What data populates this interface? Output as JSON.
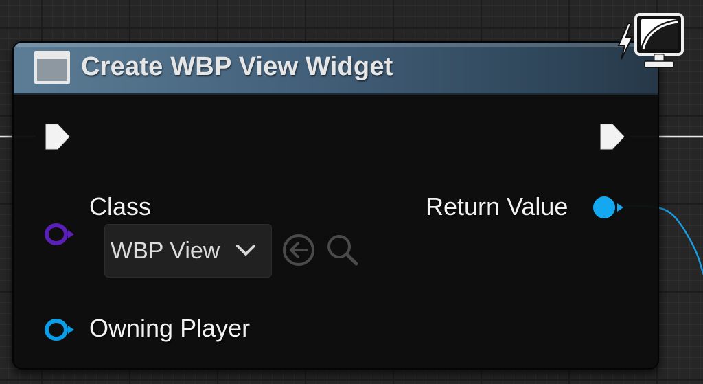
{
  "node": {
    "title": "Create WBP View Widget",
    "header_icon": "widget-icon",
    "badge_icon": "client-only-lightning-monitor-icon"
  },
  "pins": {
    "exec_in": "exec-input-pin",
    "exec_out": "exec-output-pin",
    "class": {
      "label": "Class",
      "selected_value": "WBP View",
      "browse_icon": "use-selected-asset-arrow-icon",
      "search_icon": "search-icon"
    },
    "owning_player": {
      "label": "Owning Player"
    },
    "return_value": {
      "label": "Return Value"
    }
  },
  "colors": {
    "class_pin": "#5a1fb8",
    "object_pin": "#0a9de8",
    "return_pin": "#14a8f0",
    "header": "#4a677f",
    "wire_exec": "#e8e8e8",
    "wire_data": "#1a9be0"
  }
}
